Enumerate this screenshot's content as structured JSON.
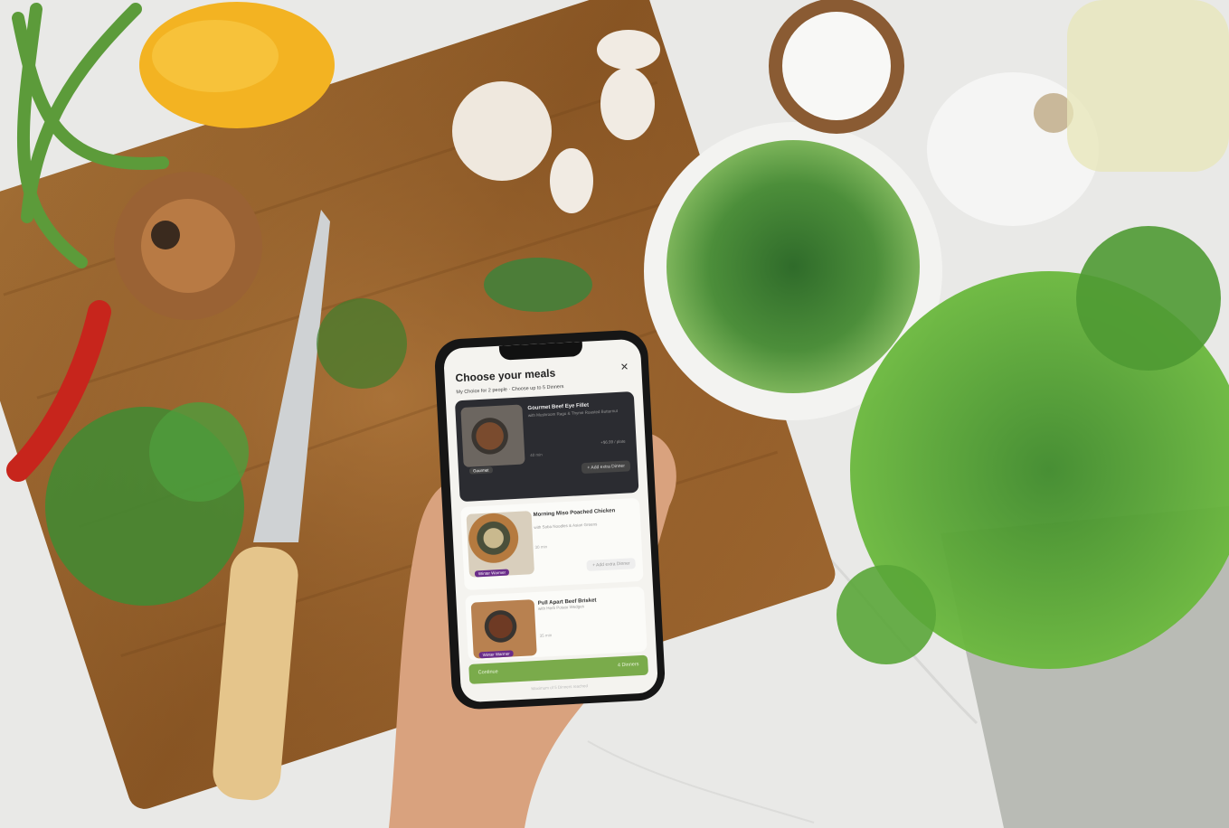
{
  "app": {
    "title": "Choose your meals",
    "close_icon": "close-icon",
    "subtitle": "My Choice for 2 people · Choose up to 5 Dinners",
    "meals": [
      {
        "name": "Gourmet Beef Eye Fillet",
        "description": "with Mushroom Ragu & Thyme Roasted Butternut",
        "time": "40 min",
        "price": "+$6.99 / plate",
        "badge": "Gourmet",
        "button": "+ Add extra Dinner"
      },
      {
        "name": "Morning Miso Poached Chicken",
        "description": "with Soba Noodles & Asian Greens",
        "time": "30 min",
        "badge": "Winter Warmer",
        "button": "+ Add extra Dinner"
      },
      {
        "name": "Pull Apart Beef Brisket",
        "description": "with Herb Potato Wedges",
        "time": "35 min",
        "badge": "Winter Warmer"
      }
    ],
    "continue_label": "Continue",
    "continue_count": "4 Dinners",
    "footnote": "Maximum of 5 Dinners reached"
  },
  "colors": {
    "accent_green": "#7aab4b",
    "dark_card": "#2b2c31",
    "badge_purple": "#6a2c8a"
  }
}
